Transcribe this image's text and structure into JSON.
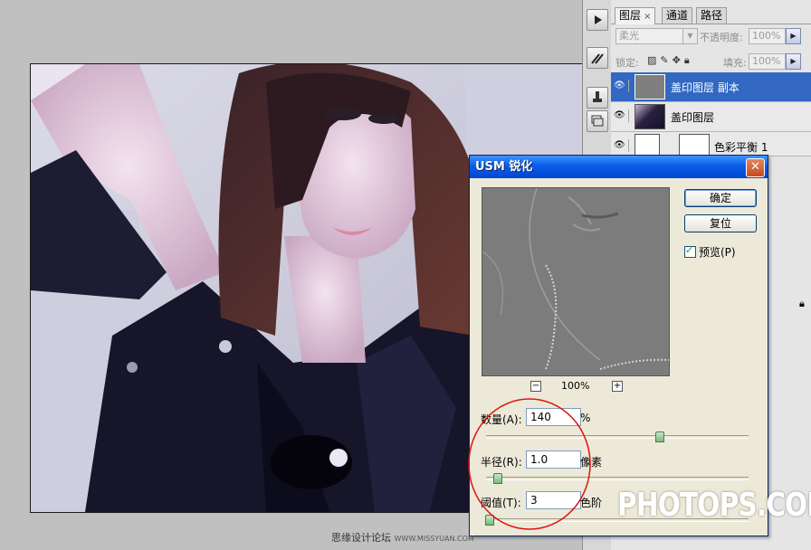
{
  "layers_panel": {
    "tabs": [
      {
        "label": "图层",
        "close": "×"
      },
      {
        "label": "通道"
      },
      {
        "label": "路径"
      }
    ],
    "blend_mode": "柔光",
    "opacity_label": "不透明度:",
    "opacity_value": "100%",
    "lock_label": "锁定:",
    "fill_label": "填充:",
    "fill_value": "100%",
    "layers": [
      {
        "name": "盖印图层 副本",
        "selected": true
      },
      {
        "name": "盖印图层",
        "selected": false
      },
      {
        "name": "色彩平衡 1",
        "selected": false
      }
    ]
  },
  "dialog": {
    "title": "USM 锐化",
    "ok_label": "确定",
    "reset_label": "复位",
    "preview_label": "预览(P)",
    "preview_checked": true,
    "zoom_value": "100%",
    "zoom_out": "−",
    "zoom_in": "+",
    "amount": {
      "label": "数量(A):",
      "value": "140",
      "unit": "%",
      "slider_fraction": 0.66
    },
    "radius": {
      "label": "半径(R):",
      "value": "1.0",
      "unit": "像素",
      "slider_fraction": 0.04
    },
    "threshold": {
      "label": "阈值(T):",
      "value": "3",
      "unit": "色阶",
      "slider_fraction": 0.01
    }
  },
  "watermark": "PHOTOPS.COM",
  "caption": {
    "main": "思缘设计论坛",
    "sub": "WWW.MISSYUAN.COM"
  },
  "colors": {
    "selection_blue": "#3268c2",
    "titlebar_blue": "#0a5de6",
    "annotation_red": "#e01010",
    "slider_green": "#7cb87c"
  },
  "icons": [
    "play-icon",
    "brush-tools-icon",
    "clone-stamp-icon",
    "layer-stack-icon",
    "eye-icon",
    "lock-icon",
    "close-icon"
  ]
}
